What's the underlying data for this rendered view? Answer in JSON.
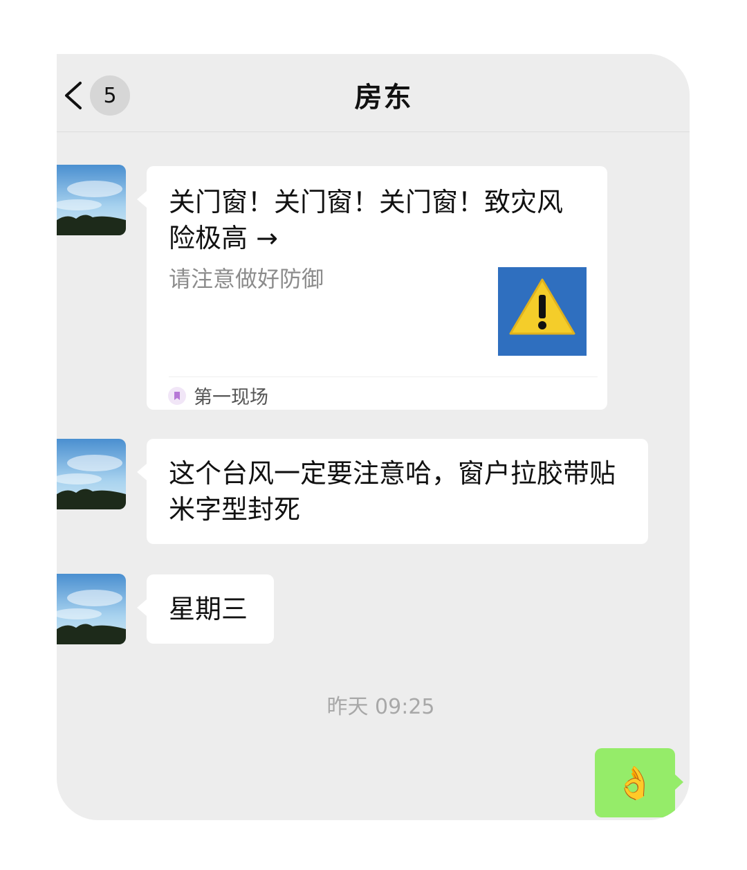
{
  "header": {
    "unread_count": "5",
    "title": "房东"
  },
  "messages": [
    {
      "type": "link_card",
      "title": "关门窗！关门窗！关门窗！致灾风险极高 →",
      "description": "请注意做好防御",
      "source": "第一现场",
      "thumbnail_icon": "warning-icon"
    },
    {
      "type": "text",
      "text": "这个台风一定要注意哈，窗户拉胶带贴米字型封死"
    },
    {
      "type": "text",
      "text": "星期三"
    }
  ],
  "timestamp": "昨天 09:25",
  "outgoing": {
    "emoji": "👌"
  },
  "colors": {
    "outgoing_bubble": "#95ec69",
    "background": "#ededed"
  }
}
